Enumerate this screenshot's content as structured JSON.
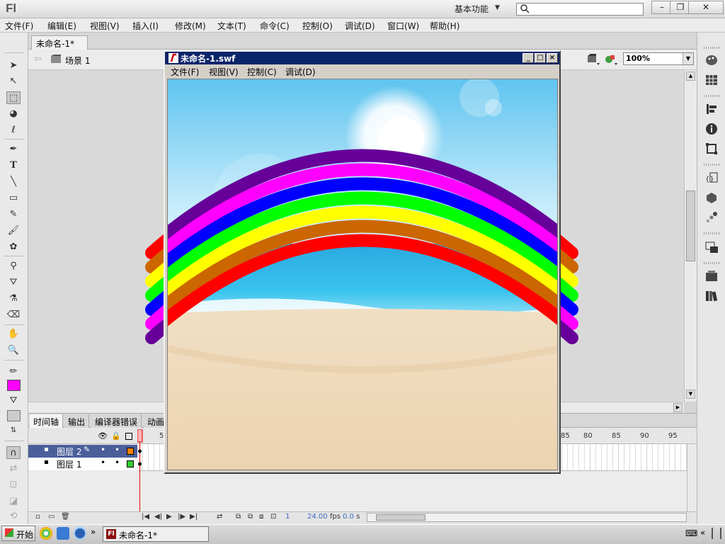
{
  "app": {
    "logo": "Fl",
    "workspace": "基本功能",
    "window_controls": [
      "–",
      "❐",
      "✕"
    ]
  },
  "menu": [
    "文件(F)",
    "编辑(E)",
    "视图(V)",
    "插入(I)",
    "修改(M)",
    "文本(T)",
    "命令(C)",
    "控制(O)",
    "调试(D)",
    "窗口(W)",
    "帮助(H)"
  ],
  "document": {
    "tab_label": "未命名-1*",
    "tab_close": "×",
    "scene": "场景 1",
    "zoom": "100%"
  },
  "timeline": {
    "tabs": [
      "时间轴",
      "输出",
      "编译器错误",
      "动画"
    ],
    "frame_numbers_left": [
      "1",
      "5"
    ],
    "frame_numbers_right": [
      "85",
      "80",
      "85",
      "90",
      "95"
    ],
    "layers": [
      {
        "name": "图层 2",
        "color": "#ff8000",
        "selected": true
      },
      {
        "name": "图层 1",
        "color": "#33cc33",
        "selected": false
      }
    ],
    "current_frame": "1",
    "fps": "24.00",
    "fps_unit": "fps",
    "time": "0.0",
    "time_unit": "s"
  },
  "swf_window": {
    "title": "未命名-1.swf",
    "menu": [
      "文件(F)",
      "视图(V)",
      "控制(C)",
      "调试(D)"
    ]
  },
  "taskbar": {
    "start": "开始",
    "chevron": "»",
    "task": "未命名-1*"
  },
  "colors": {
    "fill_color": "#ff00ff",
    "rainbow": [
      "#ff0000",
      "#cc6600",
      "#ffff00",
      "#00ff00",
      "#0000ff",
      "#ff00ff",
      "#660099"
    ]
  }
}
